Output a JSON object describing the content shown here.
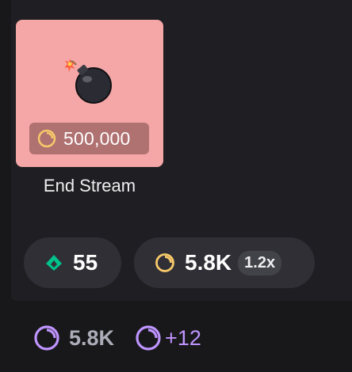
{
  "reward": {
    "title": "End Stream",
    "cost": "500,000",
    "icon": "bomb-icon",
    "card_color": "#f4a7a6"
  },
  "stats": {
    "predictions_value": "55",
    "predictions_icon": "prediction-diamond-icon",
    "points_value": "5.8K",
    "points_icon": "channel-points-icon",
    "multiplier": "1.2x"
  },
  "summary": {
    "balance": "5.8K",
    "gain": "+12",
    "icon_color": "#bf94ff"
  }
}
